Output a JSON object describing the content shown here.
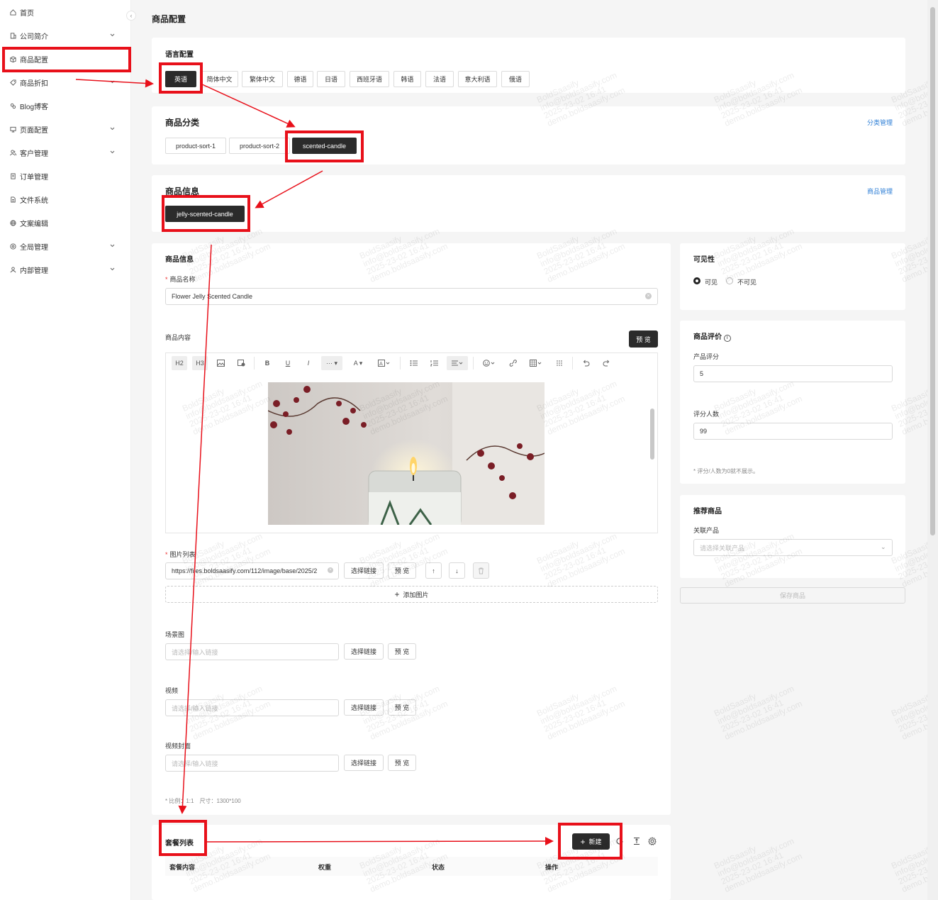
{
  "sidebar": {
    "items": [
      {
        "label": "首页",
        "icon": "home-icon",
        "chevron": false
      },
      {
        "label": "公司简介",
        "icon": "building-icon",
        "chevron": true
      },
      {
        "label": "商品配置",
        "icon": "box-icon",
        "chevron": false
      },
      {
        "label": "商品折扣",
        "icon": "tag-icon",
        "chevron": true
      },
      {
        "label": "Blog博客",
        "icon": "blog-icon",
        "chevron": false
      },
      {
        "label": "页面配置",
        "icon": "monitor-icon",
        "chevron": true
      },
      {
        "label": "客户管理",
        "icon": "users-icon",
        "chevron": true
      },
      {
        "label": "订单管理",
        "icon": "order-icon",
        "chevron": false
      },
      {
        "label": "文件系统",
        "icon": "file-icon",
        "chevron": false
      },
      {
        "label": "文案编辑",
        "icon": "globe-icon",
        "chevron": false
      },
      {
        "label": "全局管理",
        "icon": "settings-circle-icon",
        "chevron": true
      },
      {
        "label": "内部管理",
        "icon": "user-group-icon",
        "chevron": true
      }
    ]
  },
  "page_title": "商品配置",
  "language": {
    "title": "语言配置",
    "options": [
      "英语",
      "简体中文",
      "繁体中文",
      "德语",
      "日语",
      "西班牙语",
      "韩语",
      "法语",
      "意大利语",
      "俄语"
    ],
    "selected": "英语"
  },
  "category": {
    "title": "商品分类",
    "manage_link": "分类管理",
    "items": [
      "product-sort-1",
      "product-sort-2",
      "scented-candle"
    ],
    "selected": "scented-candle"
  },
  "product_list": {
    "title": "商品信息",
    "manage_link": "商品管理",
    "items": [
      "jelly-scented-candle"
    ]
  },
  "product_info": {
    "title": "商品信息",
    "name_label": "商品名称",
    "name_value": "Flower Jelly Scented Candle",
    "content_label": "商品内容",
    "preview_button": "预 览",
    "toolbar": {
      "h2": "H2",
      "h3": "H3",
      "bold": "B",
      "underline": "U",
      "italic": "I",
      "more": "··· ▾",
      "font_color": "A ▾"
    },
    "image_list_label": "图片列表",
    "image_url": "https://files.boldsaasify.com/112/image/base/2025/2",
    "select_link": "选择链接",
    "preview": "预 览",
    "add_image": "添加图片",
    "scene_label": "场景图",
    "video_label": "视频",
    "video_cover_label": "视频封面",
    "placeholder": "请选择/输入链接",
    "ratio_note": "比例：1:1　尺寸：1300*100"
  },
  "visibility": {
    "title": "可见性",
    "visible": "可见",
    "invisible": "不可见",
    "selected": "可见"
  },
  "rating": {
    "title": "商品评价",
    "score_label": "产品评分",
    "score_value": "5",
    "count_label": "评分人数",
    "count_value": "99",
    "note": "评分/人数为0就不展示。"
  },
  "recommend": {
    "title": "推荐商品",
    "related_label": "关联产品",
    "related_placeholder": "请选择关联产品"
  },
  "save_button": "保存商品",
  "package": {
    "title": "套餐列表",
    "new_button": "新建",
    "columns": [
      "套餐内容",
      "权重",
      "状态",
      "操作"
    ]
  },
  "watermark": "BoldSaasify\ninfo@boldsaasify.com\n2025-23-02 16:41\ndemo.boldsaasify.com",
  "colors": {
    "accent": "#2b2b2b",
    "link": "#2f7fd6",
    "annotation": "#e8101a",
    "required": "#e33333"
  }
}
